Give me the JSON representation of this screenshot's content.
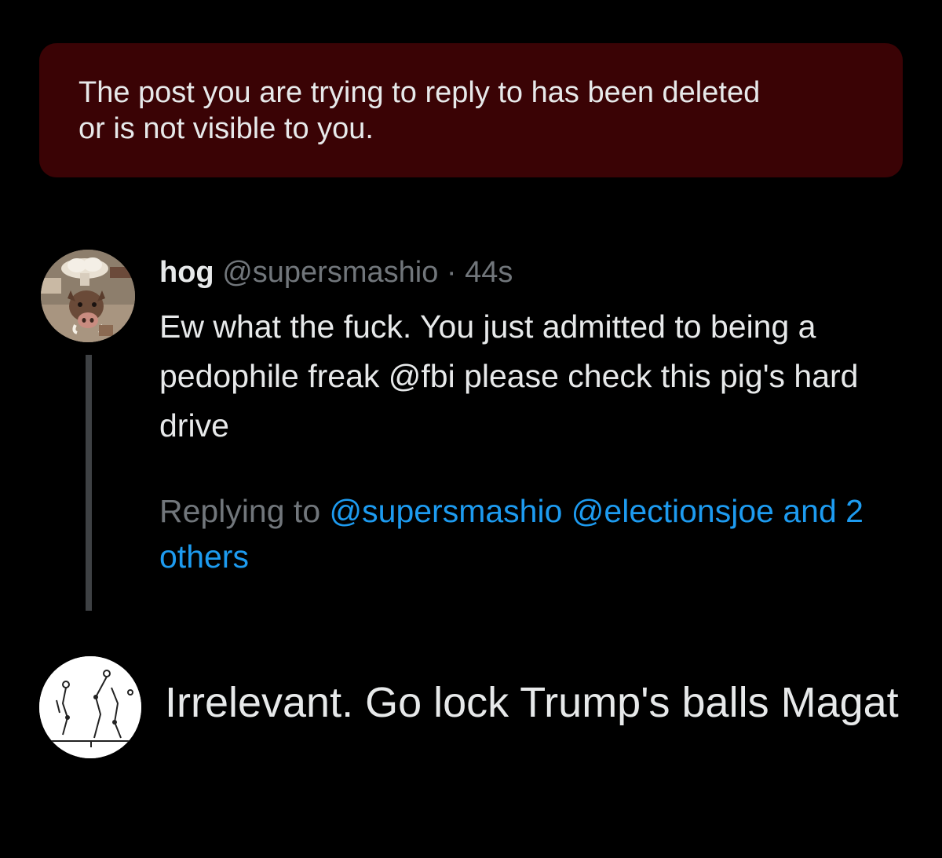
{
  "notice": {
    "text": "The post you are trying to reply to has been deleted or is not visible to you.",
    "background": "#3a0305"
  },
  "tweet": {
    "display_name": "hog",
    "handle": "@supersmashio",
    "separator": "·",
    "time": "44s",
    "body": "Ew what the fuck. You just admitted to being a pedophile freak @fbi please check this pig's hard drive",
    "replying_prefix": "Replying to",
    "replying_mentions": [
      "@supersmashio",
      "@electionsjoe"
    ],
    "replying_others": "and 2 others",
    "avatar_icon": "boar-mushroom-cloud-avatar"
  },
  "reply": {
    "text": "Irrelevant. Go lock Trump's balls Magat",
    "avatar_icon": "stick-figure-diagram-avatar"
  },
  "colors": {
    "background": "#000000",
    "text_primary": "#e7e9ea",
    "text_secondary": "#71767b",
    "link": "#1d9bf0",
    "thread_line": "#3e4144"
  }
}
